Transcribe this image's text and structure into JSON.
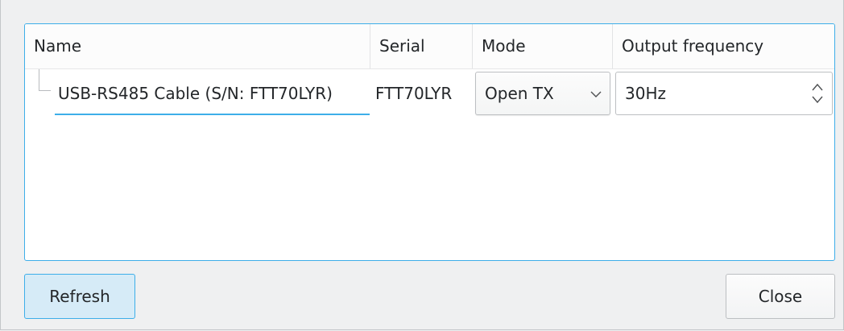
{
  "tree": {
    "columns": [
      "Name",
      "Serial",
      "Mode",
      "Output frequency"
    ],
    "rows": [
      {
        "name": "USB-RS485 Cable (S/N: FTT70LYR)",
        "serial": "FTT70LYR",
        "mode": "Open TX",
        "output_frequency": "30Hz"
      }
    ]
  },
  "icons": {
    "mode_dropdown": "chevron-down-icon",
    "frequency_spin": "up-down-arrows-icon"
  },
  "buttons": {
    "refresh": "Refresh",
    "close": "Close"
  },
  "colors": {
    "accent": "#3daee9",
    "background": "#eff0f1",
    "refresh_fill": "#d6ebf7"
  }
}
